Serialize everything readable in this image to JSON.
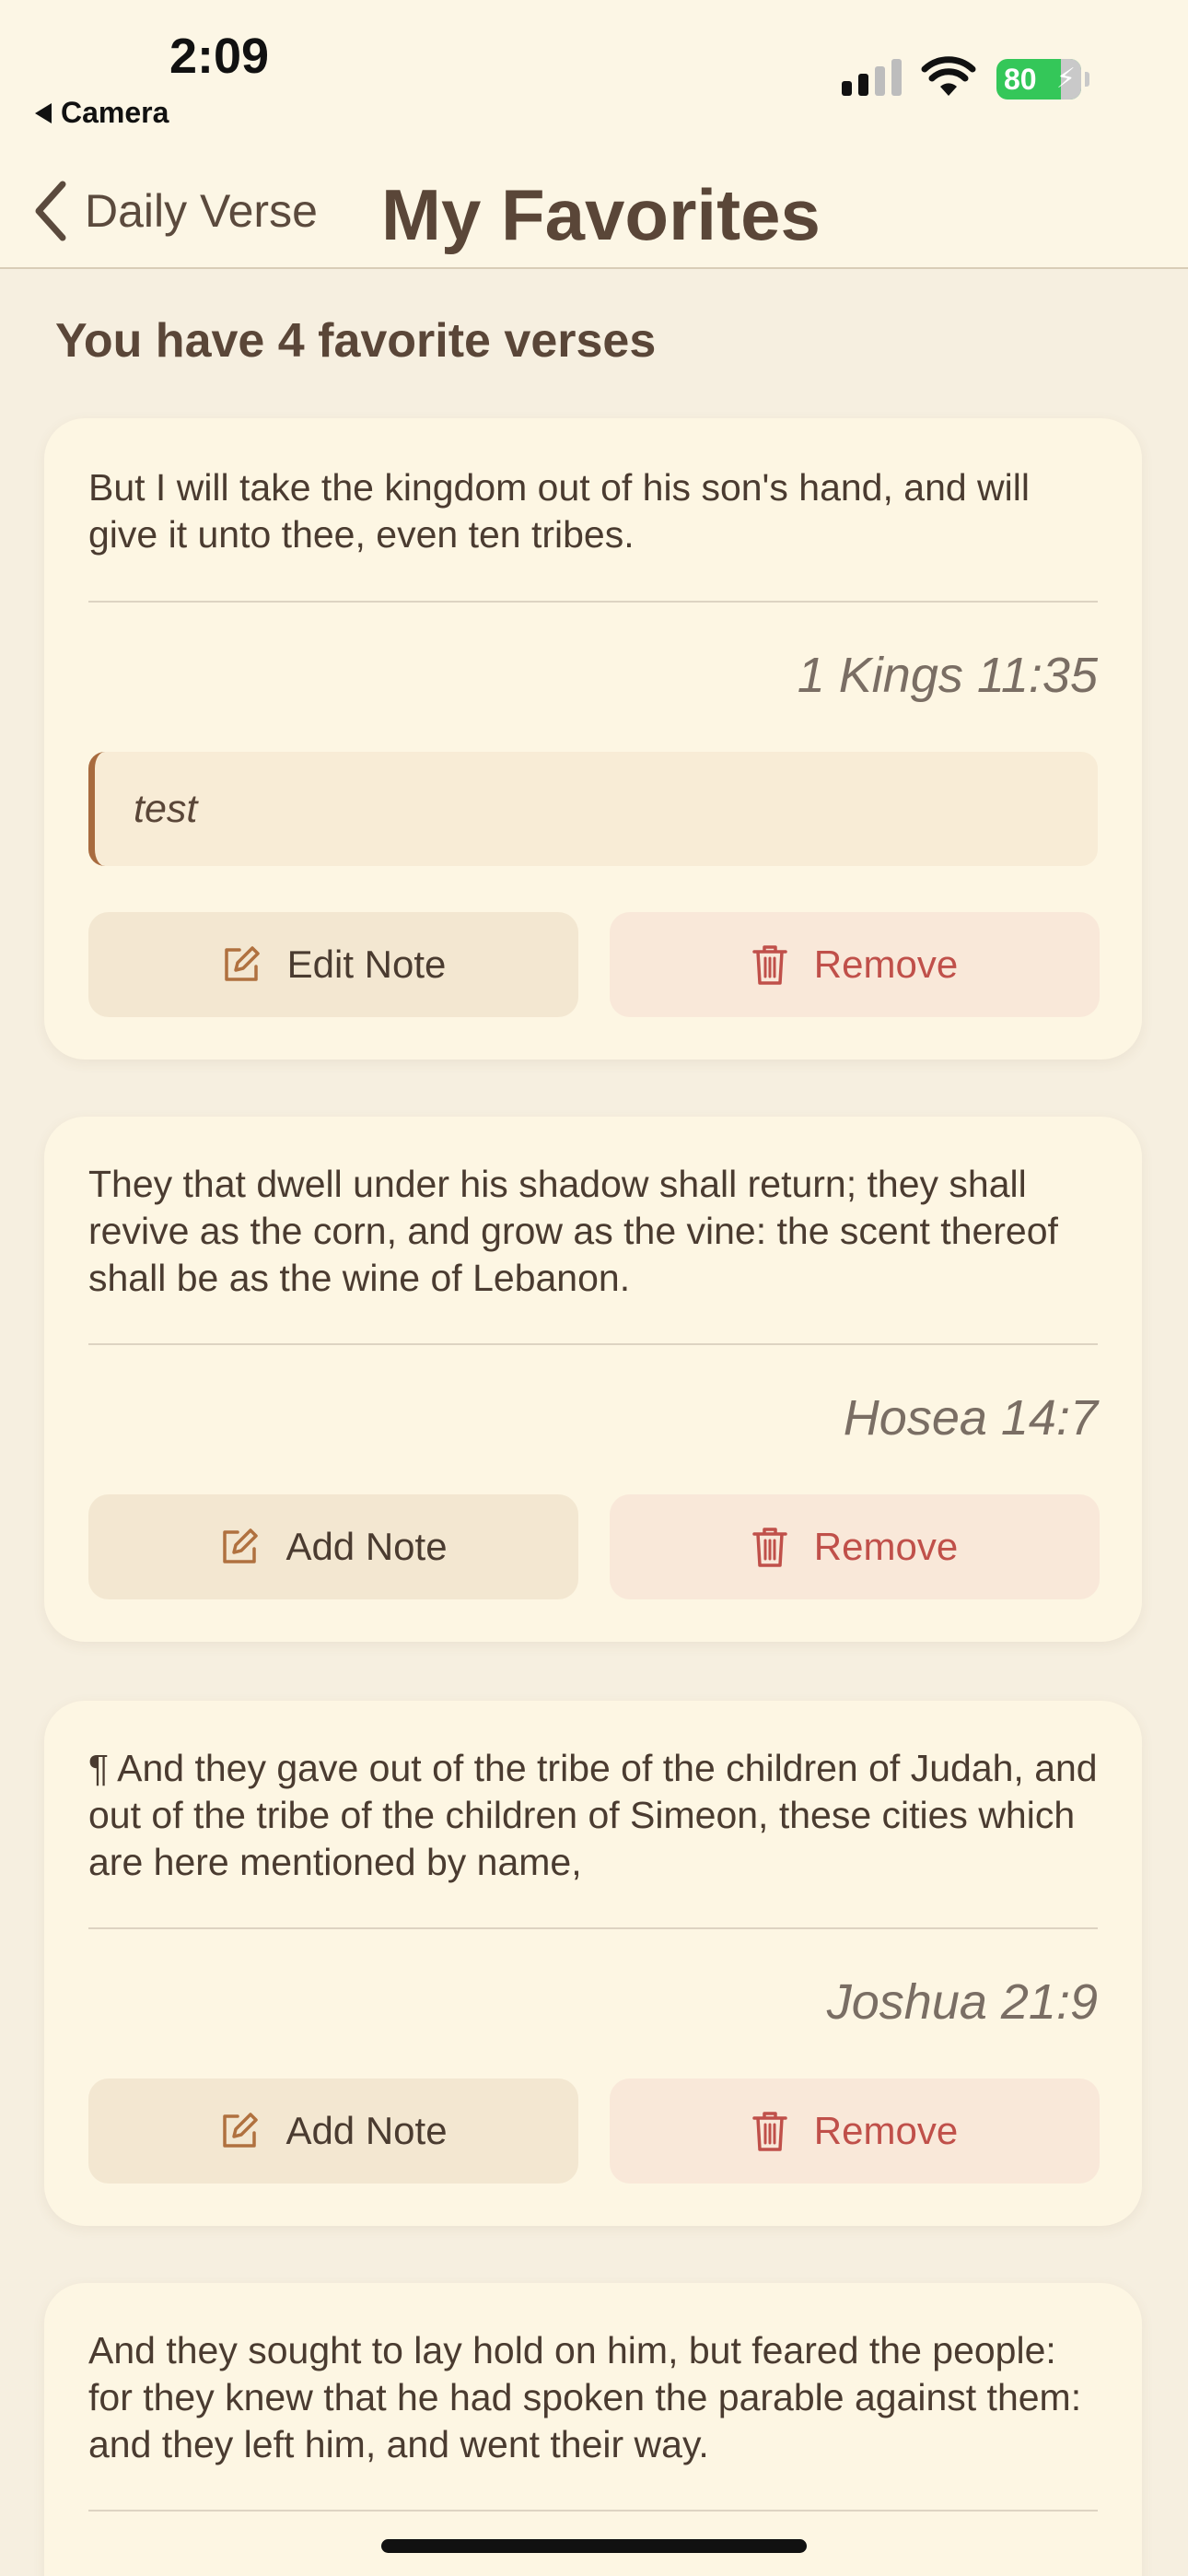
{
  "status_bar": {
    "time": "2:09",
    "back_app": "Camera",
    "battery": "80"
  },
  "nav": {
    "back_label": "Daily Verse",
    "title": "My Favorites"
  },
  "count_text": "You have 4 favorite verses",
  "favorites": [
    {
      "verse": "But I will take the kingdom out of his son's hand, and will give it unto thee, even ten tribes.",
      "reference": "1 Kings 11:35",
      "note": "test",
      "note_button": "Edit Note",
      "remove_button": "Remove"
    },
    {
      "verse": "They that dwell under his shadow shall return; they shall revive as the corn, and grow as the vine: the scent thereof shall be as the wine of Lebanon.",
      "reference": "Hosea 14:7",
      "note_button": "Add Note",
      "remove_button": "Remove"
    },
    {
      "verse": "¶ And they gave out of the tribe of the children of Judah, and out of the tribe of the children of Simeon, these cities which are here mentioned by name,",
      "reference": "Joshua 21:9",
      "note_button": "Add Note",
      "remove_button": "Remove"
    },
    {
      "verse": "And they sought to lay hold on him, but feared the people: for they knew that he had spoken the parable against them: and they left him, and went their way."
    }
  ],
  "colors": {
    "background": "#f6efe0",
    "card": "#fdf6e3",
    "accent": "#a86b3f",
    "remove": "#c0504a"
  },
  "icons": {
    "nav_back": "chevron-left-icon",
    "note": "square-pencil-icon",
    "remove": "trash-icon"
  }
}
